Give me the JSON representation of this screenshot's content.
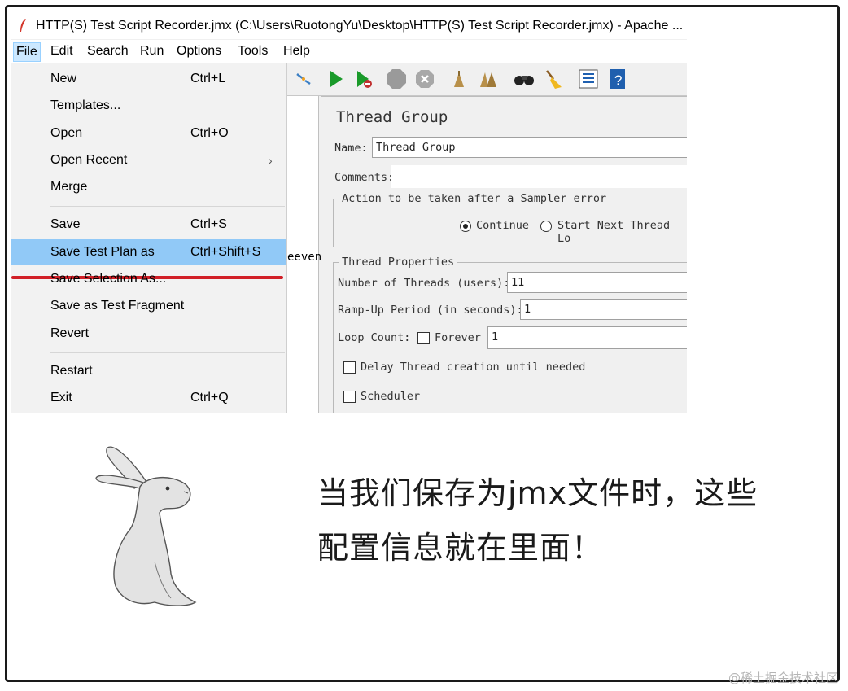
{
  "window": {
    "title": "HTTP(S) Test Script Recorder.jmx (C:\\Users\\RuotongYu\\Desktop\\HTTP(S) Test Script Recorder.jmx) - Apache ..."
  },
  "menubar": {
    "items": [
      "File",
      "Edit",
      "Search",
      "Run",
      "Options",
      "Tools",
      "Help"
    ],
    "active": "File"
  },
  "file_menu": {
    "items": [
      {
        "label": "New",
        "accel": "Ctrl+L"
      },
      {
        "label": "Templates...",
        "accel": ""
      },
      {
        "label": "Open",
        "accel": "Ctrl+O"
      },
      {
        "label": "Open Recent",
        "accel": "",
        "submenu_arrow": "›"
      },
      {
        "label": "Merge",
        "accel": ""
      },
      {
        "label": "Save",
        "accel": "Ctrl+S"
      },
      {
        "label": "Save Test Plan as",
        "accel": "Ctrl+Shift+S",
        "highlighted": true
      },
      {
        "label": "Save Selection As...",
        "accel": ""
      },
      {
        "label": "Save as Test Fragment",
        "accel": ""
      },
      {
        "label": "Revert",
        "accel": ""
      },
      {
        "label": "Restart",
        "accel": ""
      },
      {
        "label": "Exit",
        "accel": "Ctrl+Q"
      }
    ]
  },
  "toolbar": {
    "icons": [
      "expand-collapse-icon",
      "start-icon",
      "start-no-pause-icon",
      "stop-icon",
      "shutdown-icon",
      "clear-icon",
      "clear-all-icon",
      "search-binoculars-icon",
      "reset-search-broom-icon",
      "function-helper-list-icon",
      "help-book-icon"
    ]
  },
  "tree": {
    "partial_text": "eevent"
  },
  "thread_group": {
    "title": "Thread Group",
    "name_label": "Name:",
    "name_value": "Thread Group",
    "comments_label": "Comments:",
    "comments_value": "",
    "sampler_error_group": "Action to be taken after a Sampler error",
    "option_continue": "Continue",
    "option_start_next": "Start Next Thread Lo",
    "selected_option": "Continue",
    "thread_props_group": "Thread Properties",
    "threads_label": "Number of Threads (users):",
    "threads_value": "11",
    "rampup_label": "Ramp-Up Period (in seconds):",
    "rampup_value": "1",
    "loop_label": "Loop Count:",
    "forever_label": "Forever",
    "forever_checked": false,
    "loop_value": "1",
    "delay_label": "Delay Thread creation until needed",
    "delay_checked": false,
    "scheduler_label": "Scheduler",
    "scheduler_checked": false
  },
  "caption": {
    "line1": "当我们保存为jmx文件时，这些",
    "line2": "配置信息就在里面！"
  },
  "watermark": "@稀土掘金技术社区",
  "colors": {
    "highlight": "#91c9f7",
    "menu_active": "#cce8ff",
    "red_underline": "#d11f27",
    "menu_bg": "#f2f2f2"
  }
}
